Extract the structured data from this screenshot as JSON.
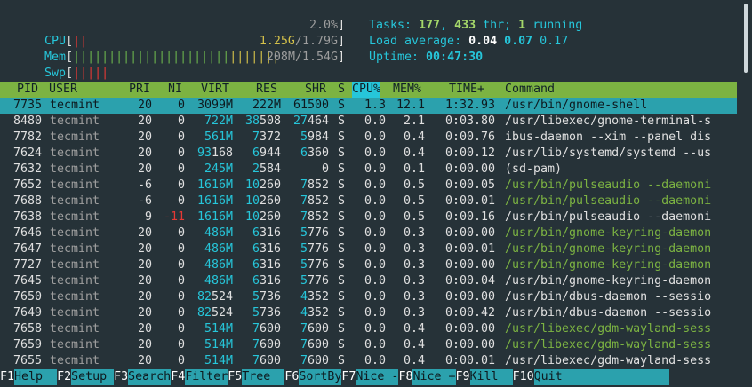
{
  "meters": {
    "cpu": {
      "label": "CPU",
      "bars": "||",
      "value": "2.0%"
    },
    "mem": {
      "label": "Mem",
      "bars_green": "||||||||||||||||||||||",
      "bars_yellow": "|||||||",
      "value_used": "1.25G",
      "value_total": "/1.79G"
    },
    "swp": {
      "label": "Swp",
      "bars": "|||||",
      "value": "208M/1.54G"
    }
  },
  "system": {
    "tasks_label": "Tasks: ",
    "tasks": "177",
    "threads_sep": ", ",
    "threads": "433",
    "threads_label": " thr; ",
    "running": "1",
    "running_label": " running",
    "load_label": "Load average: ",
    "load1": "0.04",
    "load5": "0.07",
    "load15": "0.17",
    "uptime_label": "Uptime: ",
    "uptime": "00:47:30"
  },
  "columns": [
    "PID",
    "USER",
    "PRI",
    "NI",
    "VIRT",
    "RES",
    "SHR",
    "S",
    "CPU%",
    "MEM%",
    "TIME+",
    "Command"
  ],
  "processes": [
    {
      "pid": "7735",
      "user": "tecmint",
      "pri": "20",
      "ni": "0",
      "virt": "3099M",
      "res": "222M",
      "shr": "61500",
      "s": "S",
      "cpu": "1.3",
      "mem": "12.1",
      "time": "1:32.93",
      "cmd": "/usr/bin/gnome-shell"
    },
    {
      "pid": "8480",
      "user": "tecmint",
      "pri": "20",
      "ni": "0",
      "virt": "722M",
      "res": "38508",
      "shr": "27464",
      "s": "S",
      "cpu": "0.0",
      "mem": "2.1",
      "time": "0:03.80",
      "cmd": "/usr/libexec/gnome-terminal-s"
    },
    {
      "pid": "7782",
      "user": "tecmint",
      "pri": "20",
      "ni": "0",
      "virt": "561M",
      "res": "7372",
      "shr": "5984",
      "s": "S",
      "cpu": "0.0",
      "mem": "0.4",
      "time": "0:00.76",
      "cmd": "ibus-daemon --xim --panel dis"
    },
    {
      "pid": "7624",
      "user": "tecmint",
      "pri": "20",
      "ni": "0",
      "virt": "93168",
      "res": "6944",
      "shr": "6360",
      "s": "S",
      "cpu": "0.0",
      "mem": "0.4",
      "time": "0:00.12",
      "cmd": "/usr/lib/systemd/systemd --us"
    },
    {
      "pid": "7632",
      "user": "tecmint",
      "pri": "20",
      "ni": "0",
      "virt": "245M",
      "res": "2584",
      "shr": "0",
      "s": "S",
      "cpu": "0.0",
      "mem": "0.1",
      "time": "0:00.00",
      "cmd": "(sd-pam)"
    },
    {
      "pid": "7652",
      "user": "tecmint",
      "pri": "-6",
      "ni": "0",
      "virt": "1616M",
      "res": "10260",
      "shr": "7852",
      "s": "S",
      "cpu": "0.0",
      "mem": "0.5",
      "time": "0:00.05",
      "cmd": "/usr/bin/pulseaudio --daemoni"
    },
    {
      "pid": "7688",
      "user": "tecmint",
      "pri": "-6",
      "ni": "0",
      "virt": "1616M",
      "res": "10260",
      "shr": "7852",
      "s": "S",
      "cpu": "0.0",
      "mem": "0.5",
      "time": "0:00.01",
      "cmd": "/usr/bin/pulseaudio --daemoni"
    },
    {
      "pid": "7638",
      "user": "tecmint",
      "pri": "9",
      "ni": "-11",
      "virt": "1616M",
      "res": "10260",
      "shr": "7852",
      "s": "S",
      "cpu": "0.0",
      "mem": "0.5",
      "time": "0:00.16",
      "cmd": "/usr/bin/pulseaudio --daemoni"
    },
    {
      "pid": "7646",
      "user": "tecmint",
      "pri": "20",
      "ni": "0",
      "virt": "486M",
      "res": "6316",
      "shr": "5776",
      "s": "S",
      "cpu": "0.0",
      "mem": "0.3",
      "time": "0:00.00",
      "cmd": "/usr/bin/gnome-keyring-daemon"
    },
    {
      "pid": "7647",
      "user": "tecmint",
      "pri": "20",
      "ni": "0",
      "virt": "486M",
      "res": "6316",
      "shr": "5776",
      "s": "S",
      "cpu": "0.0",
      "mem": "0.3",
      "time": "0:00.01",
      "cmd": "/usr/bin/gnome-keyring-daemon"
    },
    {
      "pid": "7727",
      "user": "tecmint",
      "pri": "20",
      "ni": "0",
      "virt": "486M",
      "res": "6316",
      "shr": "5776",
      "s": "S",
      "cpu": "0.0",
      "mem": "0.3",
      "time": "0:00.00",
      "cmd": "/usr/bin/gnome-keyring-daemon"
    },
    {
      "pid": "7645",
      "user": "tecmint",
      "pri": "20",
      "ni": "0",
      "virt": "486M",
      "res": "6316",
      "shr": "5776",
      "s": "S",
      "cpu": "0.0",
      "mem": "0.3",
      "time": "0:00.04",
      "cmd": "/usr/bin/gnome-keyring-daemon"
    },
    {
      "pid": "7650",
      "user": "tecmint",
      "pri": "20",
      "ni": "0",
      "virt": "82524",
      "res": "5736",
      "shr": "4352",
      "s": "S",
      "cpu": "0.0",
      "mem": "0.3",
      "time": "0:00.00",
      "cmd": "/usr/bin/dbus-daemon --sessio"
    },
    {
      "pid": "7649",
      "user": "tecmint",
      "pri": "20",
      "ni": "0",
      "virt": "82524",
      "res": "5736",
      "shr": "4352",
      "s": "S",
      "cpu": "0.0",
      "mem": "0.3",
      "time": "0:00.42",
      "cmd": "/usr/bin/dbus-daemon --sessio"
    },
    {
      "pid": "7658",
      "user": "tecmint",
      "pri": "20",
      "ni": "0",
      "virt": "514M",
      "res": "7600",
      "shr": "7600",
      "s": "S",
      "cpu": "0.0",
      "mem": "0.4",
      "time": "0:00.00",
      "cmd": "/usr/libexec/gdm-wayland-sess"
    },
    {
      "pid": "7659",
      "user": "tecmint",
      "pri": "20",
      "ni": "0",
      "virt": "514M",
      "res": "7600",
      "shr": "7600",
      "s": "S",
      "cpu": "0.0",
      "mem": "0.4",
      "time": "0:00.00",
      "cmd": "/usr/libexec/gdm-wayland-sess"
    },
    {
      "pid": "7655",
      "user": "tecmint",
      "pri": "20",
      "ni": "0",
      "virt": "514M",
      "res": "7600",
      "shr": "7600",
      "s": "S",
      "cpu": "0.0",
      "mem": "0.4",
      "time": "0:00.01",
      "cmd": "/usr/libexec/gdm-wayland-sess"
    }
  ],
  "function_keys": [
    {
      "key": "F1",
      "label": "Help  "
    },
    {
      "key": "F2",
      "label": "Setup "
    },
    {
      "key": "F3",
      "label": "Search"
    },
    {
      "key": "F4",
      "label": "Filter"
    },
    {
      "key": "F5",
      "label": "Tree  "
    },
    {
      "key": "F6",
      "label": "SortBy"
    },
    {
      "key": "F7",
      "label": "Nice -"
    },
    {
      "key": "F8",
      "label": "Nice +"
    },
    {
      "key": "F9",
      "label": "Kill  "
    },
    {
      "key": "F10",
      "label": "Quit"
    }
  ],
  "colors": {
    "background": "#263238",
    "header": "#7cb342",
    "selected": "#2ba1ad",
    "accent": "#26c6da"
  }
}
